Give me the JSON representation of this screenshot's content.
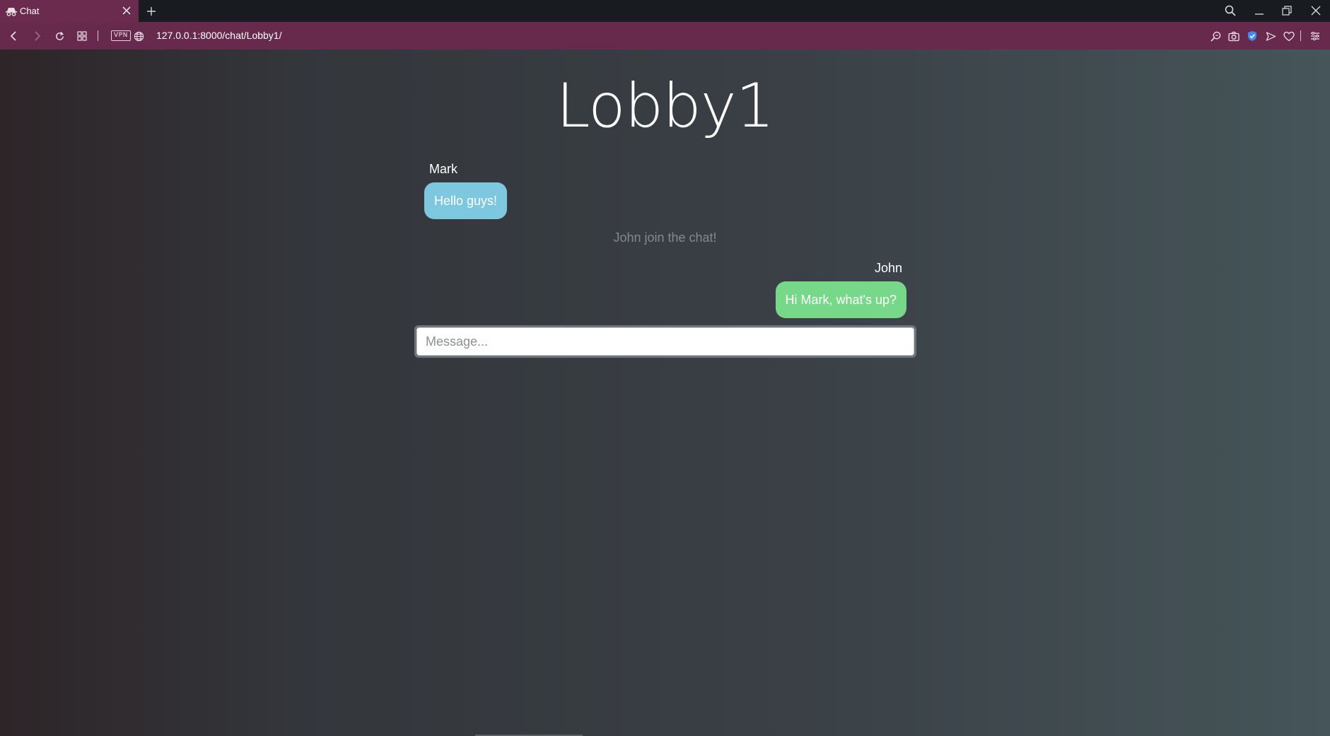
{
  "browser": {
    "tab": {
      "title": "Chat",
      "favicon": "incognito-icon"
    },
    "address": {
      "url": "127.0.0.1:8000/chat/Lobby1/",
      "vpn_label": "VPN"
    }
  },
  "chat": {
    "room_name": "Lobby1",
    "messages": [
      {
        "author": "Mark",
        "text": "Hello guys!",
        "side": "left",
        "color": "#7ec8df"
      },
      {
        "author": "John",
        "text": "Hi Mark, what's up?",
        "side": "right",
        "color": "#77d88a"
      }
    ],
    "system_message": "John join the chat!",
    "input": {
      "placeholder": "Message...",
      "value": ""
    }
  },
  "colors": {
    "tab_active": "#6b2b4e",
    "address_bar": "#672a4c",
    "bubble_left": "#7ec8df",
    "bubble_right": "#77d88a"
  }
}
